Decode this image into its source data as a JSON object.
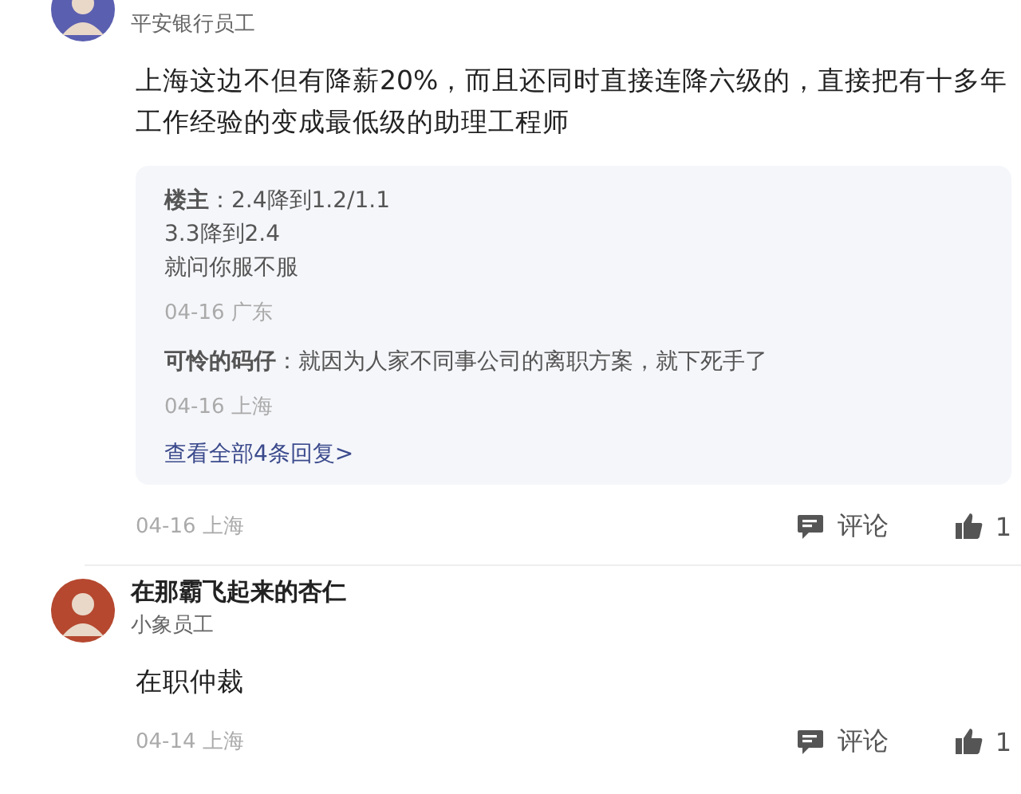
{
  "comments": [
    {
      "role": "平安银行员工",
      "color": "#5b5fb0",
      "content": "上海这边不但有降薪20%，而且还同时直接连降六级的，直接把有十多年工作经验的变成最低级的助理工程师",
      "replies": [
        {
          "lines": [
            "**楼主**：2.4降到1.2/1.1",
            "3.3降到2.4",
            "就问你服不服"
          ],
          "meta": "04-16 广东"
        },
        {
          "lines": [
            "**可怜的码仔**：就因为人家不同事公司的离职方案，就下死手了"
          ],
          "meta": "04-16 上海"
        }
      ],
      "more_link": "查看全部4条回复>",
      "meta": "04-16 上海",
      "comment_label": "评论",
      "likes": "1"
    },
    {
      "name": "在那霸飞起来的杏仁",
      "role": "小象员工",
      "color": "#b5482f",
      "content": "在职仲裁",
      "meta": "04-14 上海",
      "comment_label": "评论",
      "likes": "1"
    }
  ]
}
